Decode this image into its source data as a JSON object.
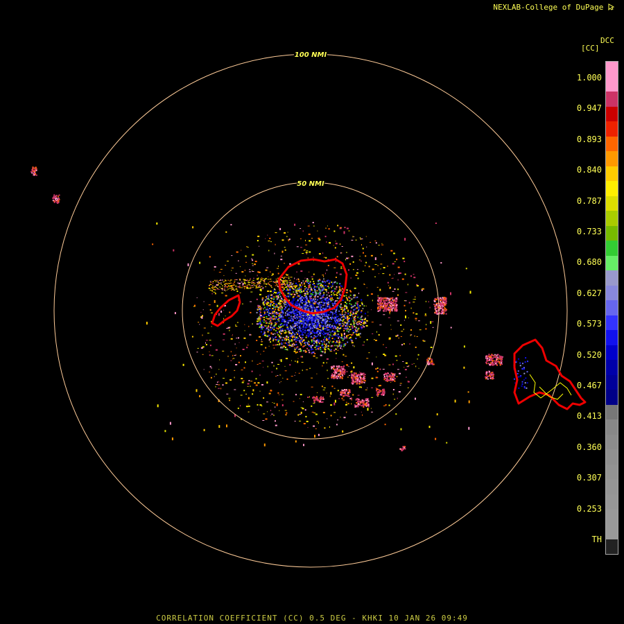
{
  "header": {
    "credit": "NEXLAB-College of DuPage",
    "credit_icon": "cursor-arrow-icon"
  },
  "scale": {
    "code": "DCC",
    "unit": "[CC]",
    "tick_labels": [
      "1.000",
      "0.947",
      "0.893",
      "0.840",
      "0.787",
      "0.733",
      "0.680",
      "0.627",
      "0.573",
      "0.520",
      "0.467",
      "0.413",
      "0.360",
      "0.307",
      "0.253",
      "TH"
    ],
    "colors": [
      "#ff99cc",
      "#ff99cc",
      "#cc3366",
      "#cc0000",
      "#ee2200",
      "#ff6600",
      "#ff9900",
      "#ffcc00",
      "#ffee00",
      "#dddd00",
      "#aacc00",
      "#77bb00",
      "#33cc33",
      "#66ee66",
      "#9999cc",
      "#8888dd",
      "#6666ee",
      "#3333ff",
      "#1111ee",
      "#0000cc",
      "#0000aa",
      "#000099",
      "#000088",
      "#777777",
      "#888888",
      "#8c8c8c",
      "#909090",
      "#939393",
      "#959595",
      "#979797",
      "#999999",
      "#999999",
      "#222222"
    ]
  },
  "map": {
    "ring_labels": [
      "100 NMI",
      "50 NMI"
    ],
    "colors": {
      "ring": "#ffcc99",
      "ring_label": "#ffff55",
      "outline": "#ee0000",
      "track": "#ffff00",
      "background": "#000000"
    }
  },
  "footer": {
    "title": "CORRELATION COEFFICIENT (CC) 0.5 DEG - KHKI 10 JAN 26 09:49"
  }
}
